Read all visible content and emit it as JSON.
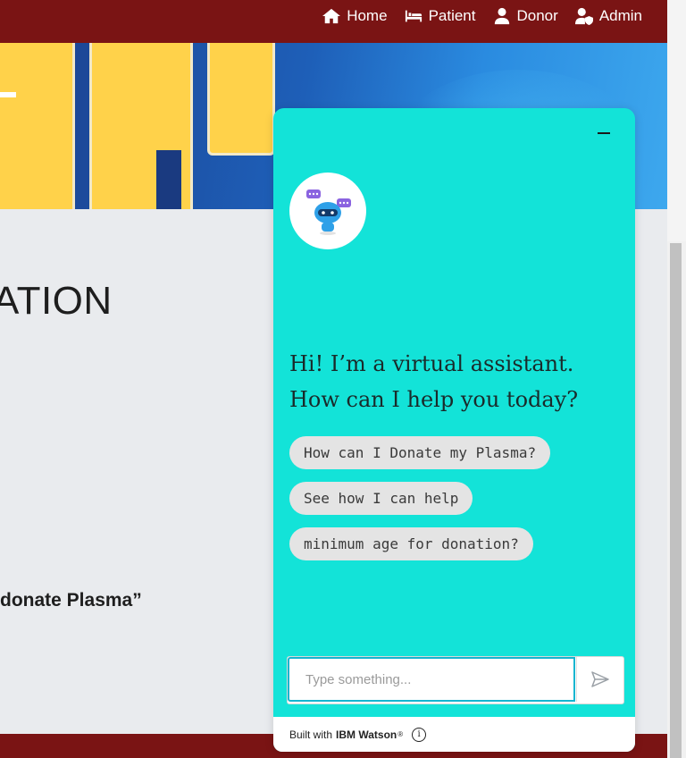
{
  "nav": {
    "items": [
      {
        "label": "Home",
        "icon": "home-icon"
      },
      {
        "label": "Patient",
        "icon": "bed-icon"
      },
      {
        "label": "Donor",
        "icon": "user-icon"
      },
      {
        "label": "Admin",
        "icon": "user-shield-icon"
      }
    ]
  },
  "page": {
    "heading_fragment": "ATION",
    "quote_fragment": "donate Plasma”"
  },
  "chat": {
    "greeting": "Hi! I’m a virtual assistant. How can I help you today?",
    "suggestions": [
      "How can I Donate my Plasma?",
      "See how I can help",
      "minimum age for donation?"
    ],
    "input_placeholder": "Type something...",
    "footer_prefix": "Built with",
    "footer_brand": "IBM Watson",
    "footer_reg": "®",
    "info_glyph": "i"
  },
  "colors": {
    "navbar": "#7a1414",
    "chat_background": "#13e3d8",
    "chip_background": "#e4e4e4"
  }
}
